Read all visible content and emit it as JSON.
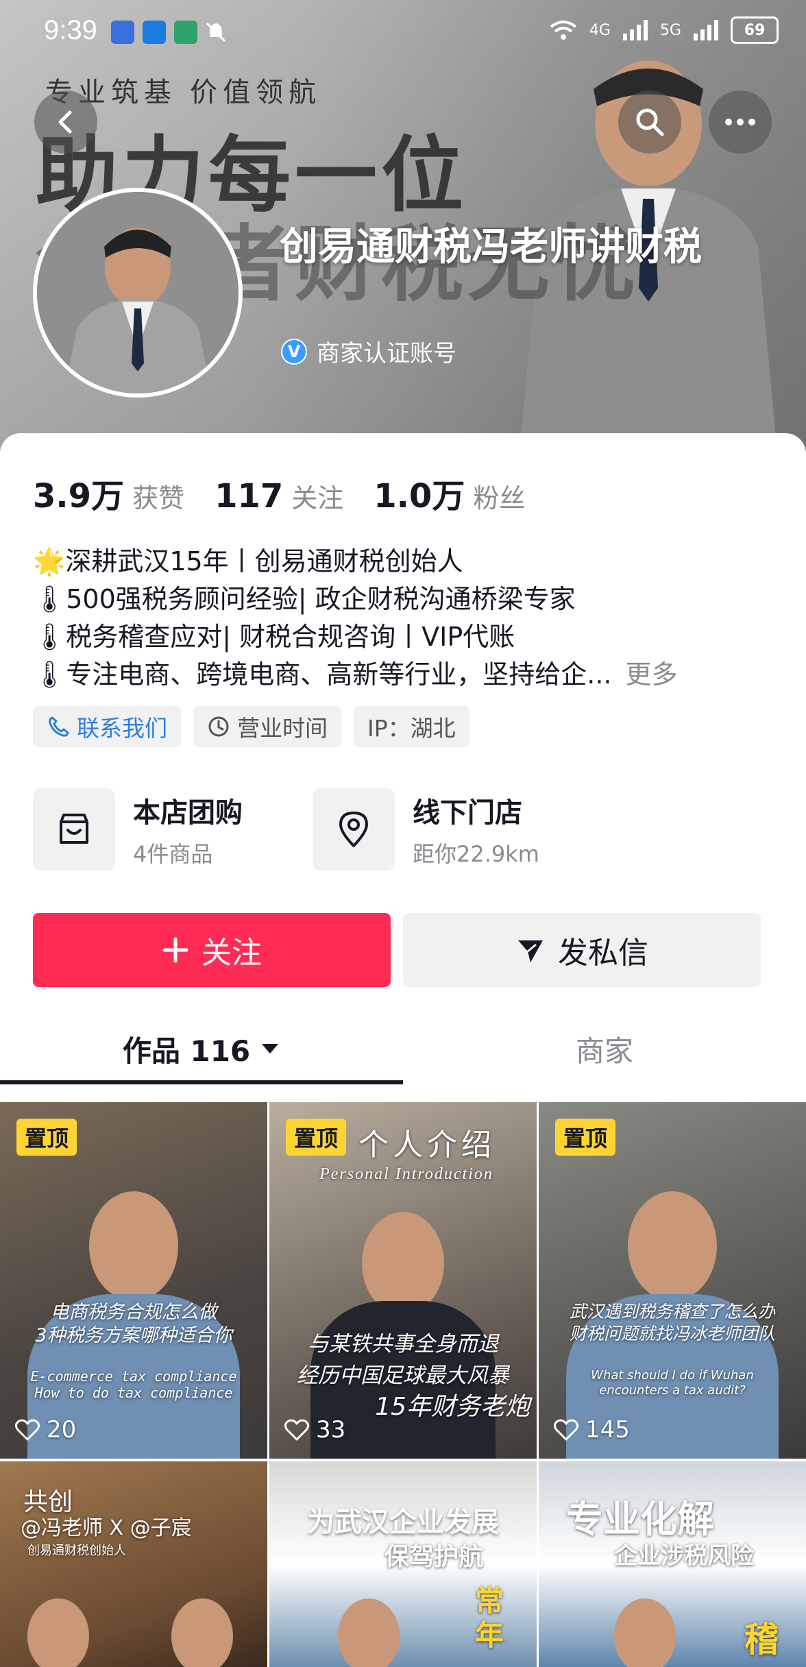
{
  "status": {
    "time": "9:39",
    "network": "4G",
    "network2": "5G",
    "battery": "69"
  },
  "banner": {
    "slogan": "专业筑基  价值领航",
    "headline": "助力每一位",
    "headline_partial": "创业者财税无忧"
  },
  "profile": {
    "name": "创易通财税冯老师讲财税",
    "verified_label": "商家认证账号",
    "verified_badge": "V"
  },
  "stats": [
    {
      "value": "3.9万",
      "label": "获赞"
    },
    {
      "value": "117",
      "label": "关注"
    },
    {
      "value": "1.0万",
      "label": "粉丝"
    }
  ],
  "bio": {
    "line1": "🌟深耕武汉15年丨创易通财税创始人",
    "line2": "🌡500强税务顾问经验| 政企财税沟通桥梁专家",
    "line3": "🌡税务稽查应对| 财税合规咨询丨VIP代账",
    "line4": "🌡专注电商、跨境电商、高新等行业，坚持给企...",
    "more": "更多"
  },
  "tags": {
    "contact": "联系我们",
    "hours": "营业时间",
    "ip": "IP：湖北"
  },
  "cards": [
    {
      "title": "本店团购",
      "sub": "4件商品"
    },
    {
      "title": "线下门店",
      "sub": "距你22.9km"
    }
  ],
  "buttons": {
    "follow": "关注",
    "message": "发私信"
  },
  "tabs": {
    "works": "作品 116",
    "merchant": "商家"
  },
  "videos": [
    {
      "pinned": "置顶",
      "likes": "20",
      "caption1": "电商税务合规怎么做",
      "caption2": "3种税务方案哪种适合你",
      "caption3": "E-commerce tax compliance",
      "caption4": "How to do tax compliance"
    },
    {
      "pinned": "置顶",
      "likes": "33",
      "title": "个人介绍",
      "subtitle": "Personal Introduction",
      "caption1": "与某铁共事全身而退",
      "caption2": "经历中国足球最大风暴",
      "caption3": "15年财务老炮"
    },
    {
      "pinned": "置顶",
      "likes": "145",
      "caption1": "武汉遇到税务稽查了怎么办",
      "caption2": "财税问题就找冯冰老师团队",
      "caption3": "What should I do if Wuhan",
      "caption4": "encounters a tax audit?"
    },
    {
      "title": "共创",
      "caption1": "@冯老师  X  @子宸",
      "caption2": "创易通财税创始人"
    },
    {
      "caption1": "为武汉企业发展",
      "caption2": "保驾护航",
      "caption3": "常",
      "caption4": "年"
    },
    {
      "caption1": "专业化解",
      "caption2": "企业涉税风险",
      "caption3": "稽"
    }
  ],
  "colors": {
    "accent": "#fe2c55",
    "pin": "#fdd431",
    "verified": "#3a9dff",
    "link": "#2b7fd9"
  }
}
